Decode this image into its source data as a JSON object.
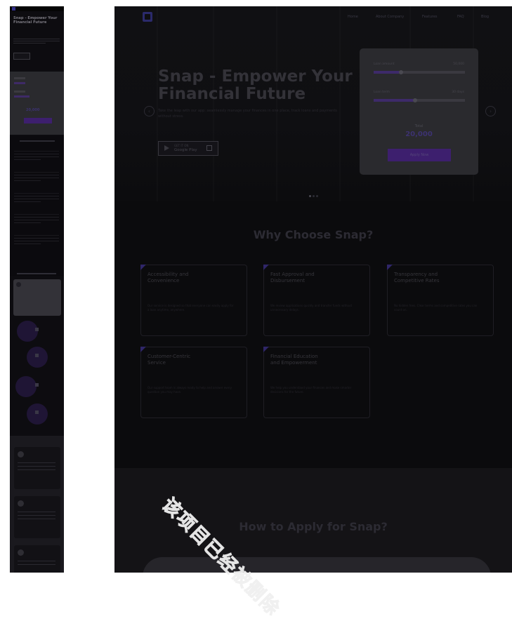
{
  "nav": {
    "items": [
      "Home",
      "About Company",
      "Features",
      "FAQ",
      "Blog"
    ]
  },
  "hero": {
    "title": "Snap - Empower Your Financial Future",
    "description": "Take the leap with our app: seamlessly manage your finances in one place, track loans and payments without stress.",
    "store_sub": "GET IT ON",
    "store_label": "Google Play",
    "prev_icon": "chevron-left-icon",
    "next_icon": "chevron-right-icon"
  },
  "calculator": {
    "amount_label": "Loan amount",
    "amount_value": "50,000",
    "term_label": "Loan term",
    "term_value": "30 days",
    "total_label": "Total",
    "total_value": "20,000",
    "apply_label": "Apply Now",
    "amount_fill": 0.3,
    "term_fill": 0.45
  },
  "slider_dots": {
    "count": 3,
    "active": 0
  },
  "why": {
    "title": "Why Choose Snap?",
    "features": [
      {
        "title": "Accessibility and Convenience",
        "desc": "Our service is designed so that everyone can easily apply for a loan anytime, anywhere."
      },
      {
        "title": "Fast Approval and Disbursement",
        "desc": "We review applications quickly and transfer funds without unnecessary delays."
      },
      {
        "title": "Transparency and Competitive Rates",
        "desc": "No hidden fees. Clear terms and competitive rates you can count on."
      },
      {
        "title": "Customer-Centric Service",
        "desc": "Our support team is always ready to help and answer every question you may have."
      },
      {
        "title": "Financial Education and Empowerment",
        "desc": "We help you understand your finances and make smarter decisions for the future."
      }
    ]
  },
  "how": {
    "title": "How to Apply for Snap?"
  },
  "watermark": "该项目已经被删除"
}
